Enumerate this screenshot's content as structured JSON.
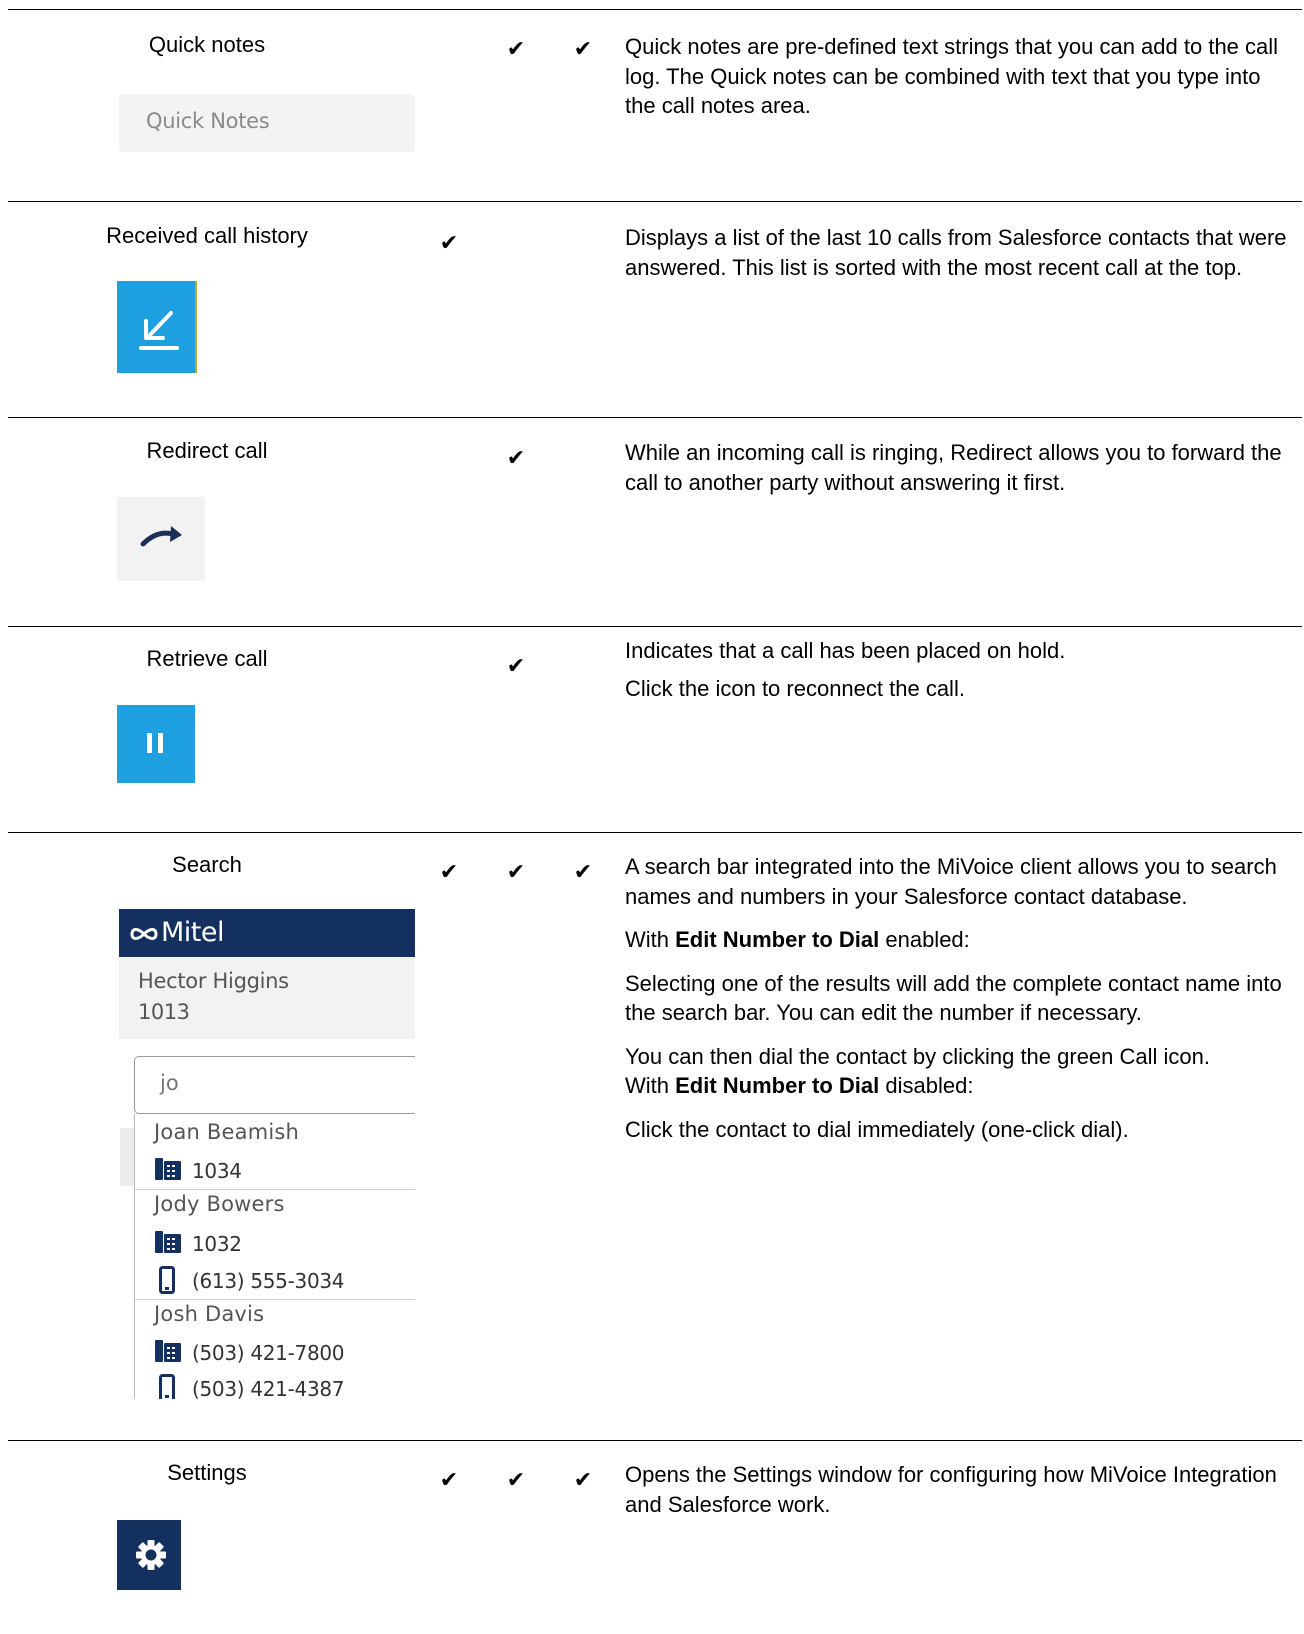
{
  "rows": [
    {
      "feature": "Quick notes",
      "input_placeholder": "Quick Notes",
      "description": [
        "Quick notes are pre-defined text strings that you can add to the call log. The Quick notes can be combined with text that you type into the call notes area."
      ]
    },
    {
      "feature": "Received call history",
      "icon": "incoming-arrow-icon",
      "description": [
        "Displays a list of the last 10 calls from Salesforce contacts that were answered. This list is sorted with the most recent call at the top."
      ]
    },
    {
      "feature": "Redirect call",
      "icon": "redirect-arrow-icon",
      "description": [
        "While an incoming call is ringing, Redirect allows you to forward the call to another party without answering it first."
      ]
    },
    {
      "feature": "Retrieve call",
      "icon": "pause-icon",
      "description": [
        "Indicates that a call has been placed on hold.",
        "Click the icon to reconnect the call."
      ]
    },
    {
      "feature": "Search",
      "description": {
        "p1": "A search bar integrated into the MiVoice client allows you to search names and numbers in your Salesforce contact database.",
        "p2_pre": "With ",
        "p2_bold": "Edit Number to Dial",
        "p2_post": " enabled:",
        "p3": "Selecting one of the results will add the complete contact name into the search bar. You can edit the number if necessary.",
        "p4": "You can then dial the contact by clicking the green Call icon.",
        "p4b_pre": "With ",
        "p4b_bold": "Edit Number to Dial",
        "p4b_post": " disabled:",
        "p5": "Click the contact to dial immediately (one-click dial)."
      },
      "mock": {
        "brand": "Mitel",
        "user_name": "Hector Higgins",
        "user_ext": "1013",
        "search_value": "jo",
        "results": [
          {
            "name": "Joan Beamish",
            "desk": "1034"
          },
          {
            "name": "Jody Bowers",
            "desk": "1032",
            "mobile": "(613) 555-3034"
          },
          {
            "name": "Josh Davis",
            "desk": "(503) 421-7800",
            "mobile": "(503) 421-4387"
          }
        ]
      }
    },
    {
      "feature": "Settings",
      "icon": "gear-icon",
      "description": [
        "Opens the Settings window for configuring how MiVoice Integration and Salesforce work."
      ]
    }
  ],
  "check_glyph": "✔",
  "colors": {
    "blue_tile": "#1ea0e0",
    "navy_tile": "#14305f",
    "gray_tile": "#f2f2f2",
    "redirect_arrow": "#1b2f57"
  }
}
